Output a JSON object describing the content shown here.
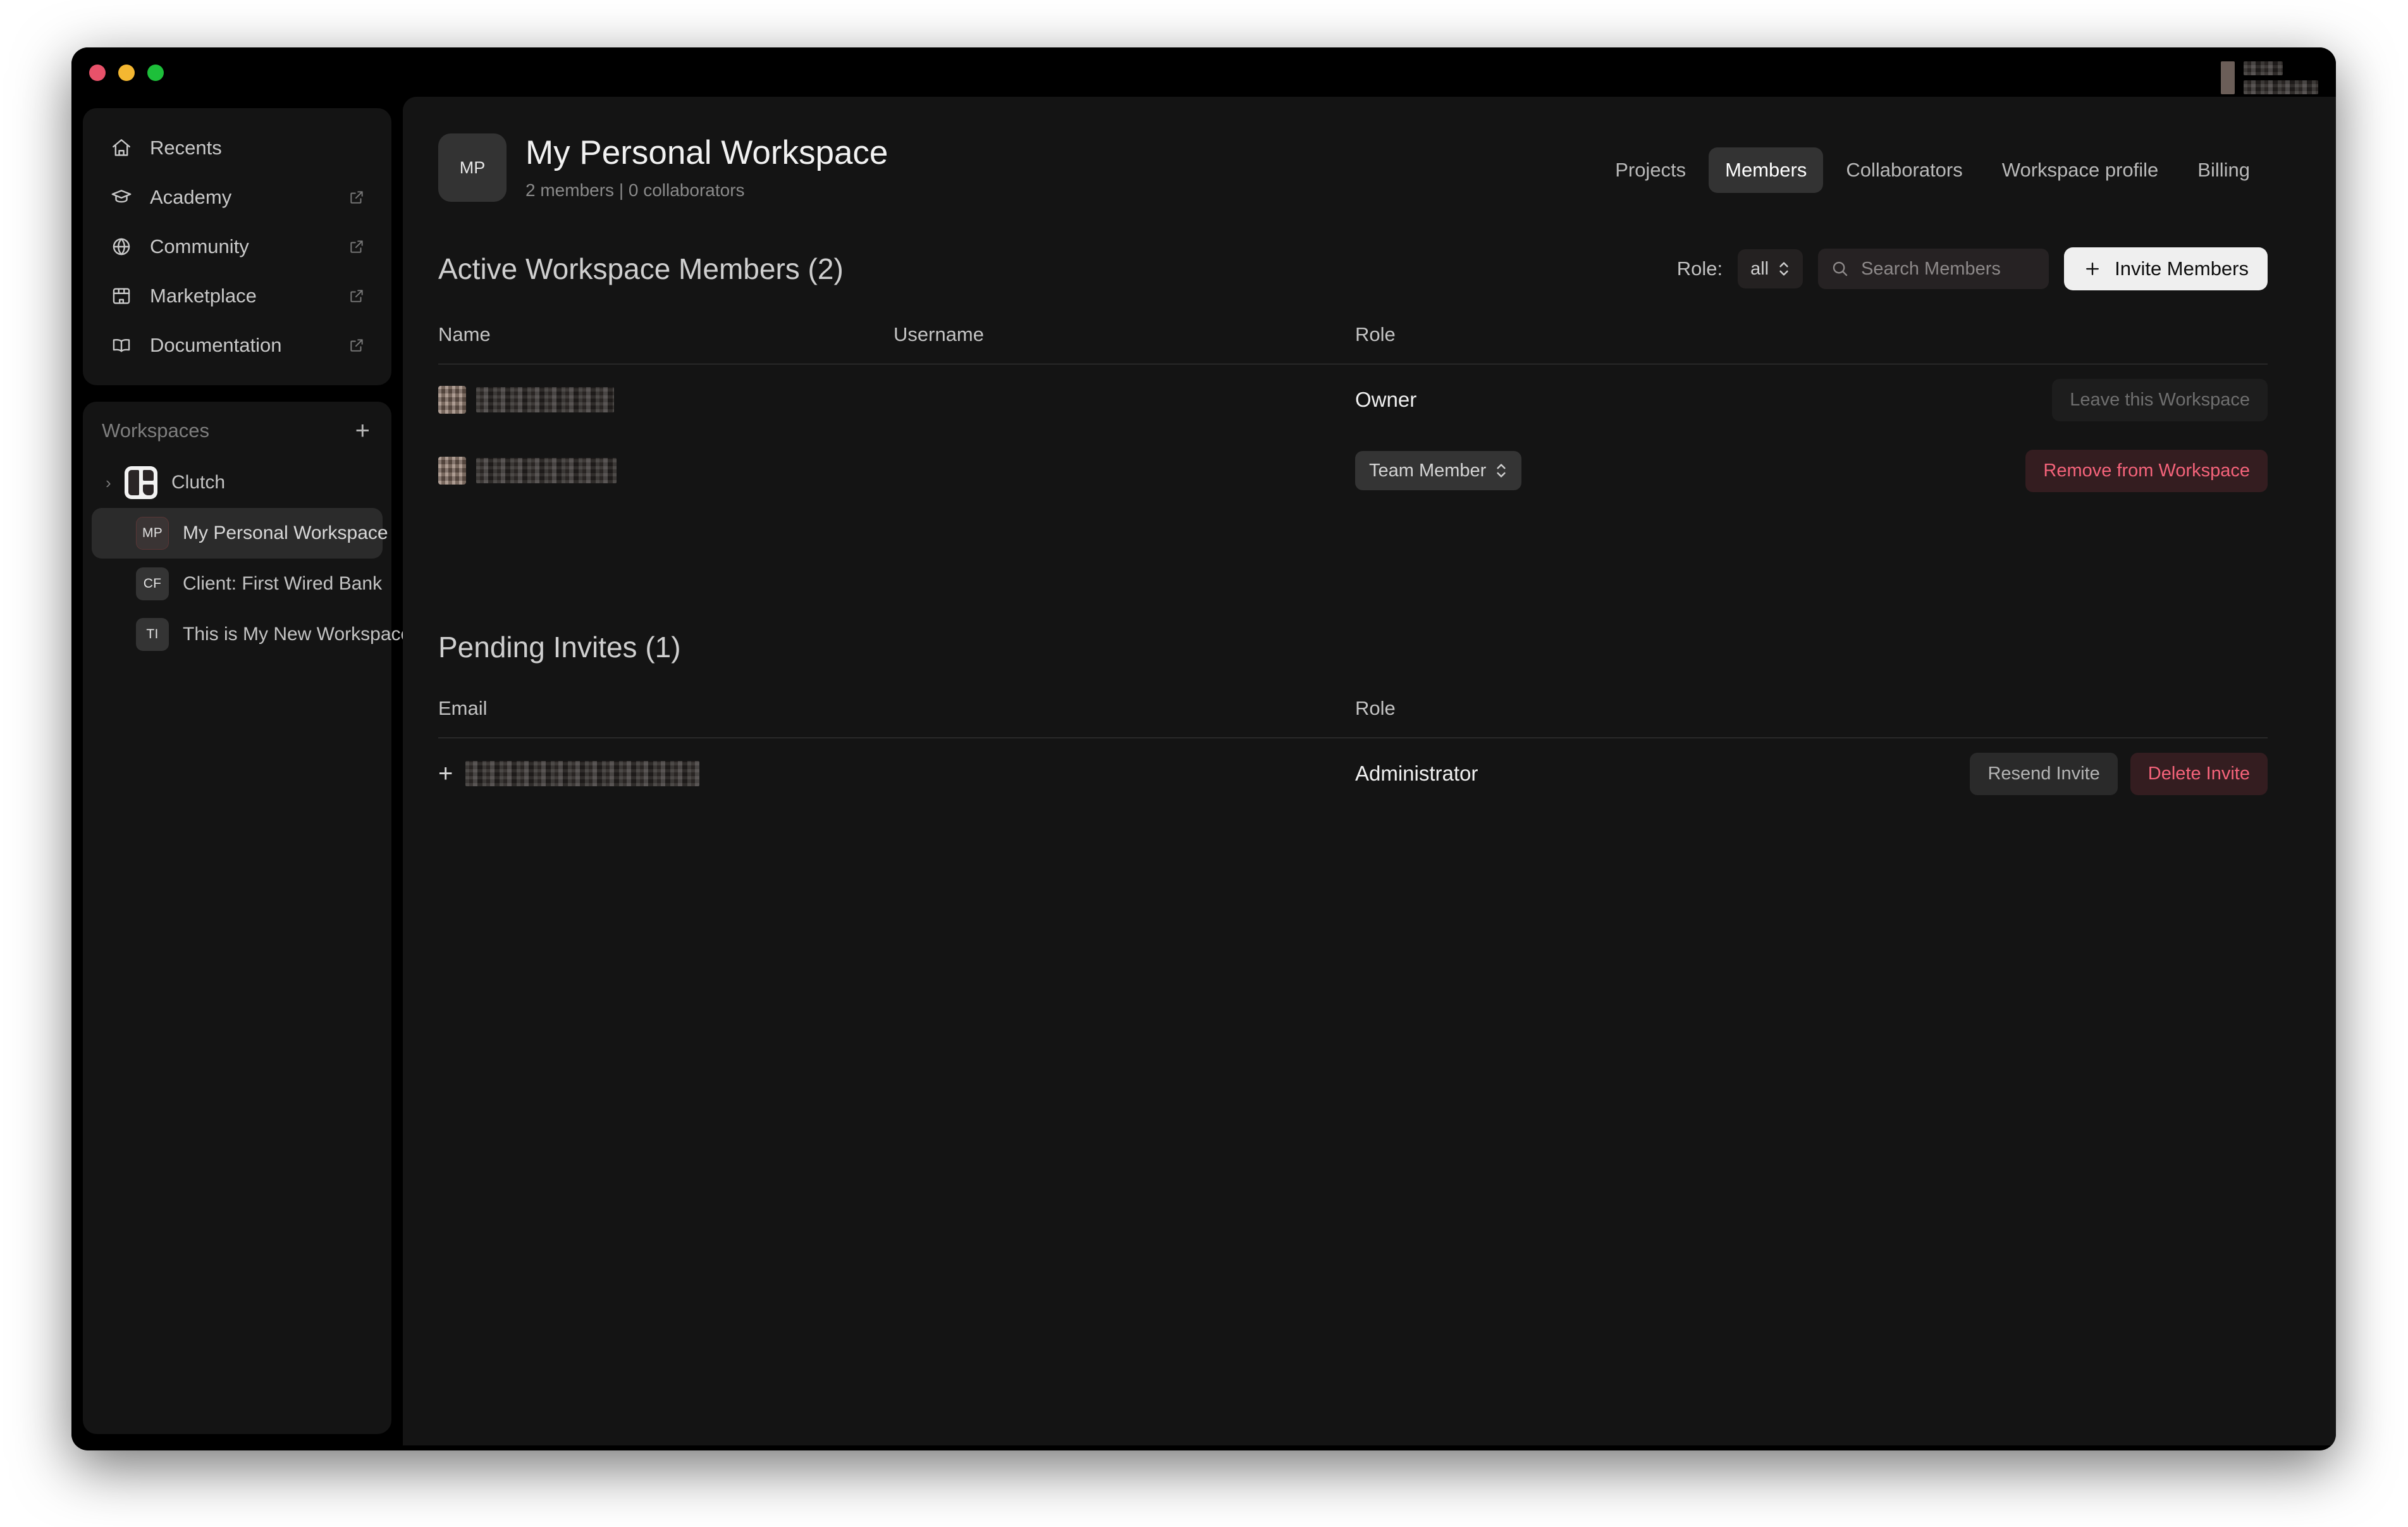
{
  "window": {
    "traffic_lights": [
      "close",
      "minimize",
      "zoom"
    ],
    "center_logo": "clutch-logo-icon",
    "user_area_redacted": true
  },
  "sidebar": {
    "nav_items": [
      {
        "label": "Recents",
        "icon": "home-icon",
        "external": false
      },
      {
        "label": "Academy",
        "icon": "graduation-cap-icon",
        "external": true
      },
      {
        "label": "Community",
        "icon": "globe-icon",
        "external": true
      },
      {
        "label": "Marketplace",
        "icon": "store-icon",
        "external": true
      },
      {
        "label": "Documentation",
        "icon": "book-icon",
        "external": true
      }
    ],
    "workspaces_header": {
      "title": "Workspaces",
      "add_label": "+"
    },
    "workspaces": [
      {
        "name": "Clutch",
        "badge": "",
        "type": "org",
        "expandable": true,
        "selected": false
      },
      {
        "name": "My Personal Workspace",
        "badge": "MP",
        "type": "workspace",
        "selected": true
      },
      {
        "name": "Client: First Wired Bank",
        "badge": "CF",
        "type": "workspace",
        "selected": false
      },
      {
        "name": "This is My New Workspace",
        "badge": "TI",
        "type": "workspace",
        "selected": false
      }
    ]
  },
  "header": {
    "avatar_initials": "MP",
    "title": "My Personal Workspace",
    "subtitle": "2 members | 0 collaborators",
    "tabs": [
      {
        "label": "Projects",
        "active": false
      },
      {
        "label": "Members",
        "active": true
      },
      {
        "label": "Collaborators",
        "active": false
      },
      {
        "label": "Workspace profile",
        "active": false
      },
      {
        "label": "Billing",
        "active": false
      }
    ]
  },
  "members_section": {
    "title": "Active Workspace Members (2)",
    "toolbar": {
      "role_label": "Role:",
      "role_value": "all",
      "search_placeholder": "Search Members",
      "search_value": "",
      "invite_button": "Invite Members"
    },
    "columns": [
      "Name",
      "Username",
      "Role"
    ],
    "rows": [
      {
        "name": "[redacted]",
        "username": "",
        "role": "Owner",
        "role_is_select": false,
        "action": "Leave this Workspace",
        "action_style": "ghost"
      },
      {
        "name": "[redacted]",
        "username": "",
        "role": "Team Member",
        "role_is_select": true,
        "action": "Remove from Workspace",
        "action_style": "danger"
      }
    ]
  },
  "pending_section": {
    "title": "Pending Invites (1)",
    "columns": [
      "Email",
      "Role"
    ],
    "rows": [
      {
        "email": "[redacted]",
        "role": "Administrator",
        "resend_label": "Resend Invite",
        "delete_label": "Delete Invite"
      }
    ]
  },
  "colors": {
    "app_background": "#000000",
    "panel": "#141414",
    "accent_button": "#efefef",
    "danger": "#f4637a",
    "danger_bg": "#341d20",
    "selected_tab_bg": "#333333"
  }
}
